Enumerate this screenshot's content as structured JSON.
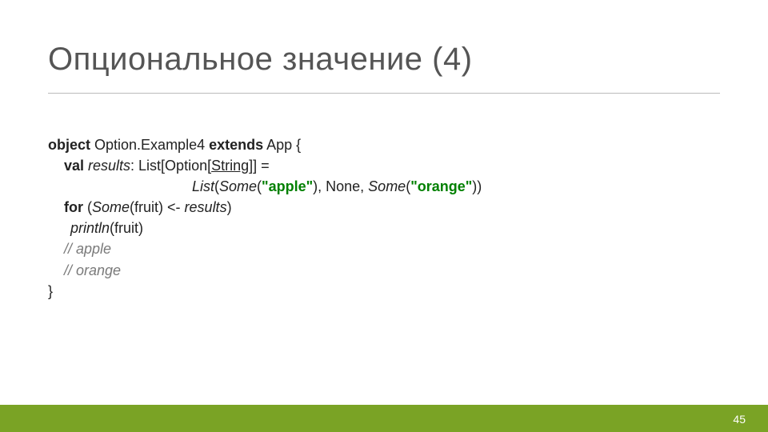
{
  "title": "Опциональное значение (4)",
  "code": {
    "l1": {
      "kw1": "object",
      "t1": " Option.Example4 ",
      "kw2": "extends",
      "t2": " App {"
    },
    "l2": {
      "kw": "val ",
      "id": "results",
      "t1": ": List[Option[",
      "u": "String",
      "t2": "]] ="
    },
    "l3": {
      "t1": "List",
      "t2": "(",
      "id1": "Some",
      "t3": "(",
      "s1": "\"apple\"",
      "t4": "), None, ",
      "id2": "Some",
      "t5": "(",
      "s2": "\"orange\"",
      "t6": "))"
    },
    "l4": {
      "kw": "for ",
      "t1": "(",
      "id1": "Some",
      "t2": "(fruit) <- ",
      "id2": "results",
      "t3": ")"
    },
    "l5": {
      "id": "println",
      "t": "(fruit)"
    },
    "l6": "// apple",
    "l7": "// orange",
    "l8": "}"
  },
  "page": "45"
}
